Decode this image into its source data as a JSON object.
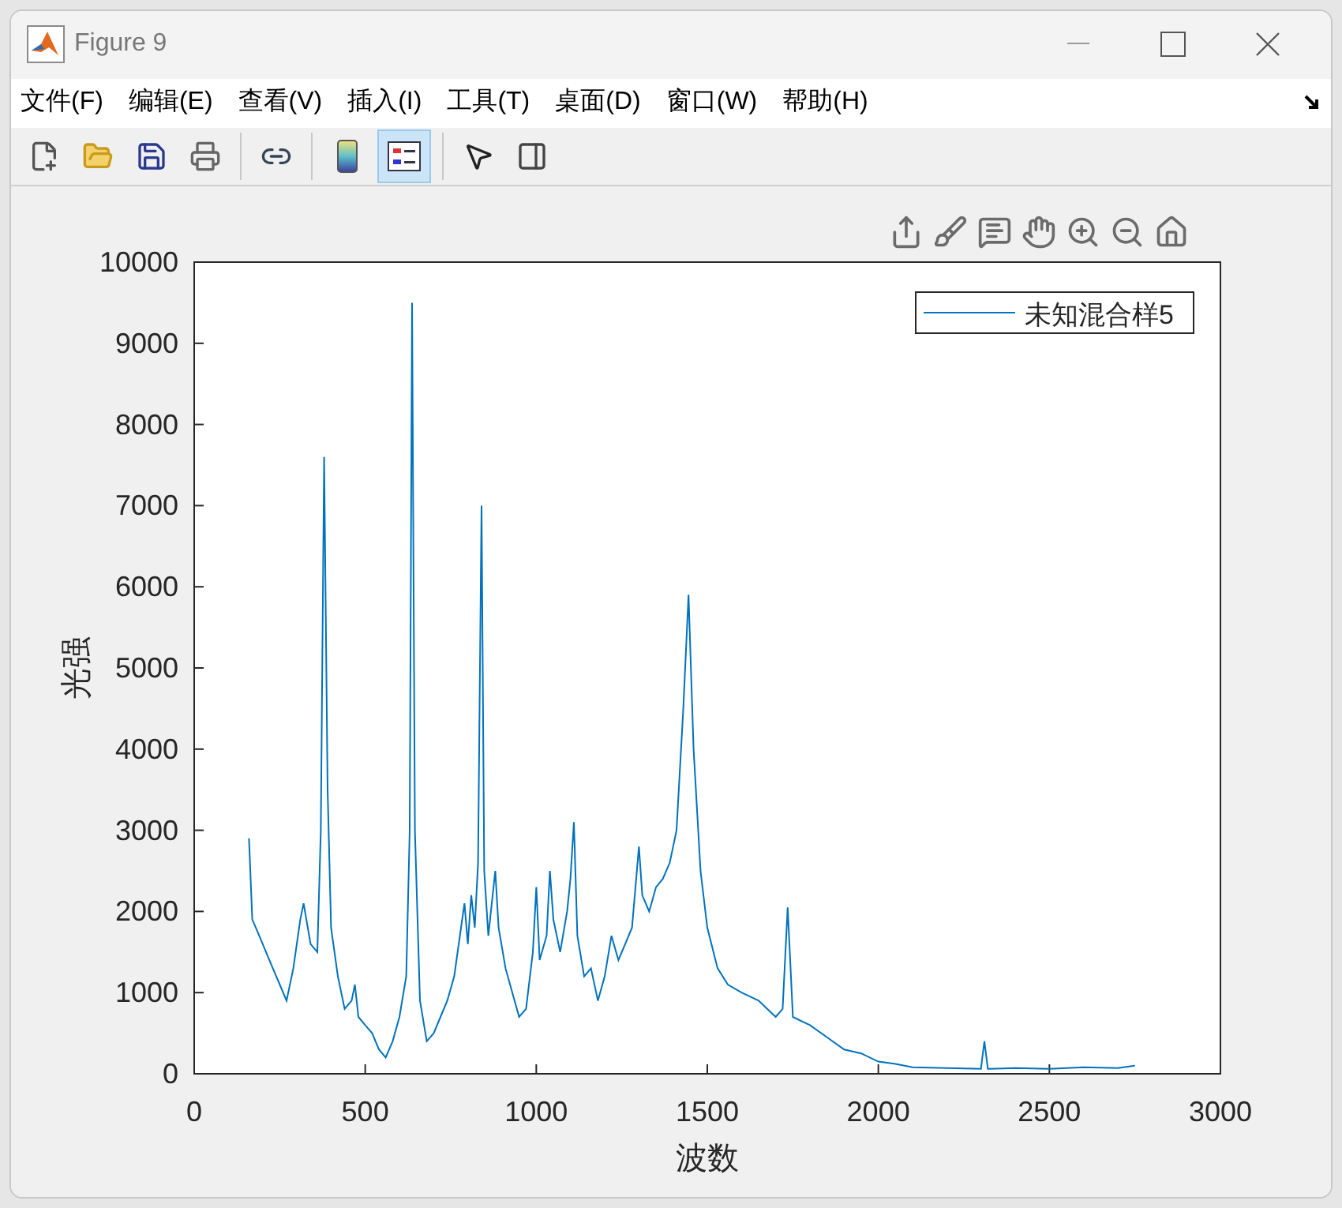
{
  "window": {
    "title": "Figure 9"
  },
  "menu": [
    "文件(F)",
    "编辑(E)",
    "查看(V)",
    "插入(I)",
    "工具(T)",
    "桌面(D)",
    "窗口(W)",
    "帮助(H)"
  ],
  "toolbar": [
    {
      "kind": "new",
      "selected": false
    },
    {
      "kind": "open",
      "selected": false
    },
    {
      "kind": "save",
      "selected": false
    },
    {
      "kind": "print",
      "selected": false
    },
    {
      "kind": "link",
      "selected": false
    },
    {
      "kind": "colorbar",
      "selected": false
    },
    {
      "kind": "legend",
      "selected": true
    },
    {
      "kind": "pointer",
      "selected": false
    },
    {
      "kind": "inspector",
      "selected": false
    }
  ],
  "axes_toolbar": [
    {
      "kind": "export"
    },
    {
      "kind": "brush"
    },
    {
      "kind": "datatip"
    },
    {
      "kind": "pan"
    },
    {
      "kind": "zoomin"
    },
    {
      "kind": "zoomout"
    },
    {
      "kind": "home"
    }
  ],
  "chart_data": {
    "type": "line",
    "xlabel": "波数",
    "ylabel": "光强",
    "xlim": [
      0,
      3000
    ],
    "ylim": [
      0,
      10000
    ],
    "xticks": [
      0,
      500,
      1000,
      1500,
      2000,
      2500,
      3000
    ],
    "yticks": [
      0,
      1000,
      2000,
      3000,
      4000,
      5000,
      6000,
      7000,
      8000,
      9000,
      10000
    ],
    "x": [
      160,
      170,
      190,
      210,
      230,
      250,
      270,
      290,
      310,
      320,
      340,
      360,
      370,
      380,
      390,
      400,
      420,
      440,
      460,
      470,
      480,
      500,
      520,
      540,
      560,
      580,
      600,
      620,
      630,
      637,
      645,
      660,
      680,
      700,
      720,
      740,
      760,
      780,
      790,
      800,
      810,
      820,
      830,
      840,
      848,
      860,
      880,
      890,
      910,
      930,
      950,
      970,
      990,
      1000,
      1010,
      1030,
      1040,
      1050,
      1070,
      1090,
      1100,
      1110,
      1120,
      1140,
      1160,
      1180,
      1200,
      1220,
      1240,
      1260,
      1280,
      1300,
      1310,
      1330,
      1350,
      1370,
      1390,
      1410,
      1430,
      1445,
      1460,
      1480,
      1500,
      1530,
      1560,
      1600,
      1650,
      1700,
      1720,
      1735,
      1750,
      1800,
      1850,
      1900,
      1950,
      2000,
      2050,
      2100,
      2200,
      2300,
      2310,
      2320,
      2400,
      2500,
      2600,
      2700,
      2750
    ],
    "series": [
      {
        "name": "未知混合样5",
        "color": "#0072bd",
        "values": [
          2900,
          1900,
          1700,
          1500,
          1300,
          1100,
          900,
          1300,
          1900,
          2100,
          1600,
          1500,
          3000,
          7600,
          3500,
          1800,
          1200,
          800,
          900,
          1100,
          700,
          600,
          500,
          300,
          200,
          400,
          700,
          1200,
          3000,
          9500,
          3000,
          900,
          400,
          500,
          700,
          900,
          1200,
          1800,
          2100,
          1600,
          2200,
          1800,
          2600,
          7000,
          2500,
          1700,
          2500,
          1800,
          1300,
          1000,
          700,
          800,
          1500,
          2300,
          1400,
          1700,
          2500,
          1900,
          1500,
          2000,
          2400,
          3100,
          1700,
          1200,
          1300,
          900,
          1200,
          1700,
          1400,
          1600,
          1800,
          2800,
          2200,
          2000,
          2300,
          2400,
          2600,
          3000,
          4500,
          5900,
          4000,
          2500,
          1800,
          1300,
          1100,
          1000,
          900,
          700,
          800,
          2050,
          700,
          600,
          450,
          300,
          250,
          150,
          120,
          80,
          70,
          60,
          400,
          60,
          70,
          60,
          80,
          70,
          100
        ]
      }
    ]
  }
}
